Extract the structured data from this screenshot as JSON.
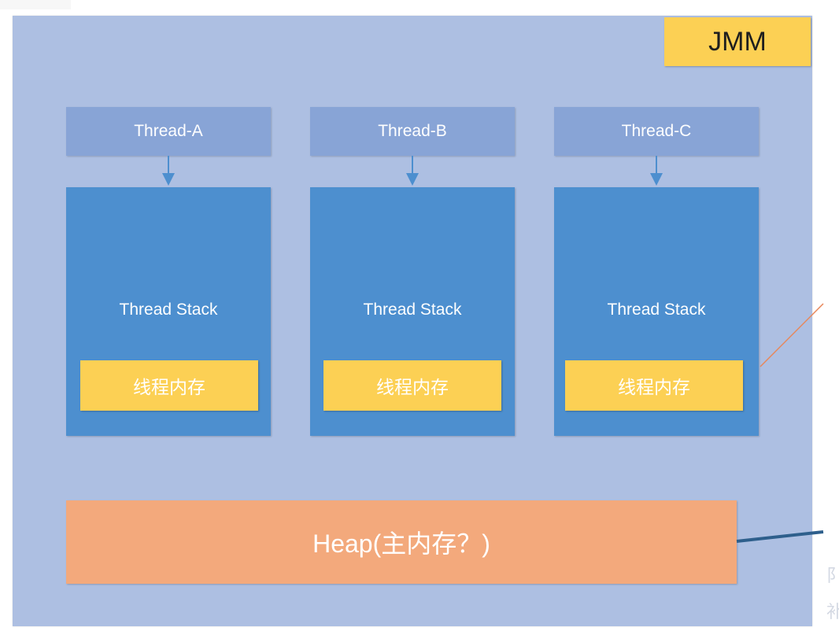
{
  "badge": "JMM",
  "threads": [
    {
      "name": "Thread-A",
      "stack": "Thread Stack",
      "memory": "线程内存"
    },
    {
      "name": "Thread-B",
      "stack": "Thread Stack",
      "memory": "线程内存"
    },
    {
      "name": "Thread-C",
      "stack": "Thread Stack",
      "memory": "线程内存"
    }
  ],
  "heap": "Heap(主内存？)",
  "edge_glyphs": [
    "阝",
    "补"
  ],
  "colors": {
    "frame": "#adbfe2",
    "thread_box": "#88a4d6",
    "stack_box": "#4d8fcf",
    "memory_box": "#fcd054",
    "heap_box": "#f3a97c",
    "arrow": "#4d8fcf"
  }
}
